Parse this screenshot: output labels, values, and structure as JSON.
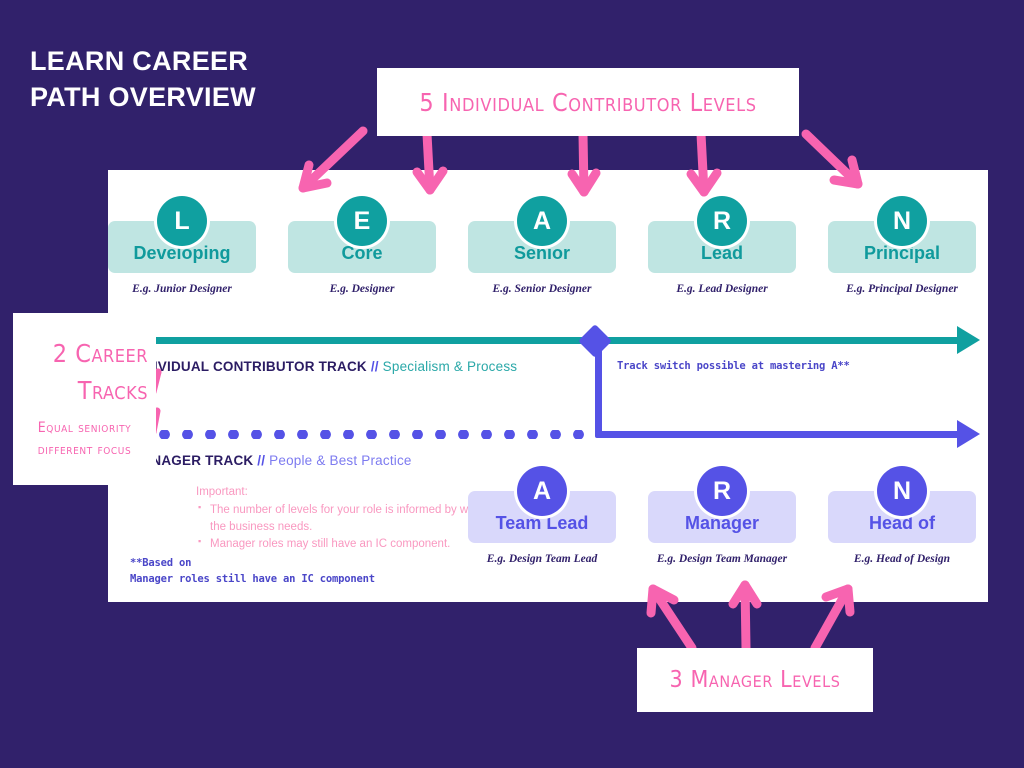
{
  "slide": {
    "title_line1": "LEARN CAREER",
    "title_line2": "PATH OVERVIEW",
    "background_color": "#31216b"
  },
  "callouts": {
    "top": "5 Individual Contributor Levels",
    "bottom": "3 Manager Levels",
    "left_title_line1": "2 Career",
    "left_title_line2": "Tracks",
    "left_sub_line1": "Equal seniority",
    "left_sub_line2": "different focus"
  },
  "colors": {
    "teal": "#10a0a0",
    "teal_chip": "#bfe5e2",
    "purple": "#5552e6",
    "purple_chip": "#d9d8fb",
    "pink": "#f764b0",
    "navy": "#2b1c63"
  },
  "ic_track": {
    "label_main": "INDIVIDUAL CONTRIBUTOR TRACK",
    "label_slash": "//",
    "label_sub": "Specialism & Process",
    "switch_note": "Track switch possible at mastering A**",
    "levels": [
      {
        "letter": "L",
        "name": "Developing",
        "example": "E.g. Junior Designer"
      },
      {
        "letter": "E",
        "name": "Core",
        "example": "E.g.  Designer"
      },
      {
        "letter": "A",
        "name": "Senior",
        "example": "E.g. Senior Designer"
      },
      {
        "letter": "R",
        "name": "Lead",
        "example": "E.g. Lead Designer"
      },
      {
        "letter": "N",
        "name": "Principal",
        "example": "E.g. Principal Designer"
      }
    ]
  },
  "manager_track": {
    "label_main": "MANAGER TRACK",
    "label_slash": "//",
    "label_sub": "People & Best Practice",
    "levels": [
      {
        "letter": "A",
        "name": "Team Lead",
        "example": "E.g. Design Team Lead"
      },
      {
        "letter": "R",
        "name": "Manager",
        "example": "E.g.  Design Team Manager"
      },
      {
        "letter": "N",
        "name": "Head of",
        "example": "E.g.  Head of Design"
      }
    ]
  },
  "important": {
    "header": "Important:",
    "bullets": [
      "The number of levels for your role is informed by what the business needs.",
      "Manager roles may still have an IC component."
    ]
  },
  "footnote": {
    "line1": "**Based on",
    "line2": "Manager roles still have an IC component"
  }
}
